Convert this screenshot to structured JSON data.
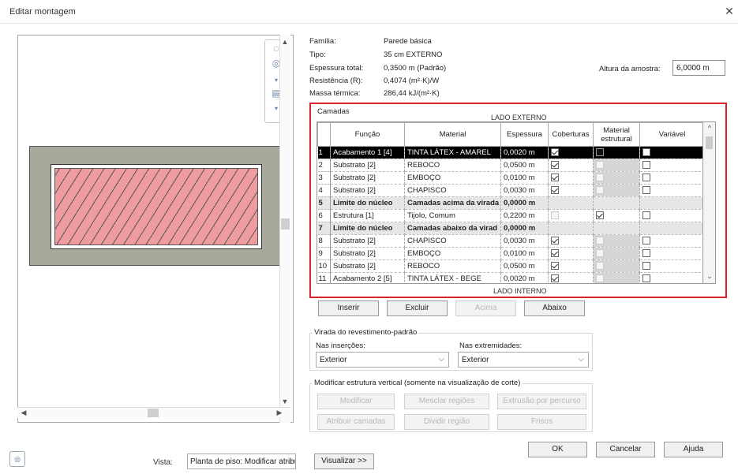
{
  "window": {
    "title": "Editar montagem"
  },
  "properties": {
    "familia_label": "Família:",
    "familia_value": "Parede básica",
    "tipo_label": "Tipo:",
    "tipo_value": "35 cm EXTERNO",
    "espessura_label": "Espessura total:",
    "espessura_value": "0,3500 m (Padrão)",
    "resistencia_label": "Resistência (R):",
    "resistencia_value": "0,4074 (m²·K)/W",
    "massa_label": "Massa térmica:",
    "massa_value": "286,44 kJ/(m²·K)",
    "altura_label": "Altura da amostra:",
    "altura_value": "6,0000 m"
  },
  "layers": {
    "group_label": "Camadas",
    "exterior_label": "LADO EXTERNO",
    "interior_label": "LADO INTERNO",
    "columns": [
      "Função",
      "Material",
      "Espessura",
      "Coberturas",
      "Material estrutural",
      "Variável"
    ],
    "rows": [
      {
        "n": "1",
        "funcao": "Acabamento 1 [4]",
        "material": "TINTA LÁTEX - AMAREL",
        "espessura": "0,0020 m",
        "cob": "on",
        "est": "blk",
        "var": "off",
        "style": "selected"
      },
      {
        "n": "2",
        "funcao": "Substrato [2]",
        "material": "REBOCO",
        "espessura": "0,0500 m",
        "cob": "on",
        "est": "dis",
        "var": "off",
        "style": ""
      },
      {
        "n": "3",
        "funcao": "Substrato [2]",
        "material": "EMBOÇO",
        "espessura": "0,0100 m",
        "cob": "on",
        "est": "dis",
        "var": "off",
        "style": ""
      },
      {
        "n": "4",
        "funcao": "Substrato [2]",
        "material": "CHAPISCO",
        "espessura": "0,0030 m",
        "cob": "on",
        "est": "dis",
        "var": "off",
        "style": ""
      },
      {
        "n": "5",
        "funcao": "Limite do núcleo",
        "material": "Camadas acima da virada",
        "espessura": "0,0000 m",
        "cob": "",
        "est": "",
        "var": "",
        "style": "core"
      },
      {
        "n": "6",
        "funcao": "Estrutura [1]",
        "material": "Tijolo, Comum",
        "espessura": "0,2200 m",
        "cob": "dis",
        "est": "on",
        "var": "off",
        "style": ""
      },
      {
        "n": "7",
        "funcao": "Limite do núcleo",
        "material": "Camadas abaixo da virad",
        "espessura": "0,0000 m",
        "cob": "",
        "est": "",
        "var": "",
        "style": "core"
      },
      {
        "n": "8",
        "funcao": "Substrato [2]",
        "material": "CHAPISCO",
        "espessura": "0,0030 m",
        "cob": "on",
        "est": "dis",
        "var": "off",
        "style": ""
      },
      {
        "n": "9",
        "funcao": "Substrato [2]",
        "material": "EMBOÇO",
        "espessura": "0,0100 m",
        "cob": "on",
        "est": "dis",
        "var": "off",
        "style": ""
      },
      {
        "n": "10",
        "funcao": "Substrato [2]",
        "material": "REBOCO",
        "espessura": "0,0500 m",
        "cob": "on",
        "est": "dis",
        "var": "off",
        "style": ""
      },
      {
        "n": "11",
        "funcao": "Acabamento 2 [5]",
        "material": "TINTA LÁTEX - BEGE",
        "espessura": "0,0020 m",
        "cob": "on",
        "est": "dis",
        "var": "off",
        "style": ""
      }
    ]
  },
  "layer_buttons": {
    "inserir": "Inserir",
    "excluir": "Excluir",
    "acima": "Acima",
    "abaixo": "Abaixo"
  },
  "wrapping": {
    "title": "Virada do revestimento-padrão",
    "insercoes_label": "Nas inserções:",
    "insercoes_value": "Exterior",
    "extremidades_label": "Nas extremidades:",
    "extremidades_value": "Exterior"
  },
  "vertical": {
    "title": "Modificar estrutura vertical (somente na visualização de corte)",
    "modificar": "Modificar",
    "mesclar": "Mesclar regiões",
    "extrusao": "Extrusão por percurso",
    "atribuir": "Atribuir camadas",
    "dividir": "Dividir região",
    "frisos": "Frisos"
  },
  "footer": {
    "ok": "OK",
    "cancelar": "Cancelar",
    "ajuda": "Ajuda",
    "vista_label": "Vista:",
    "vista_value": "Planta de piso: Modificar atribui",
    "visualizar": "Visualizar >>"
  }
}
